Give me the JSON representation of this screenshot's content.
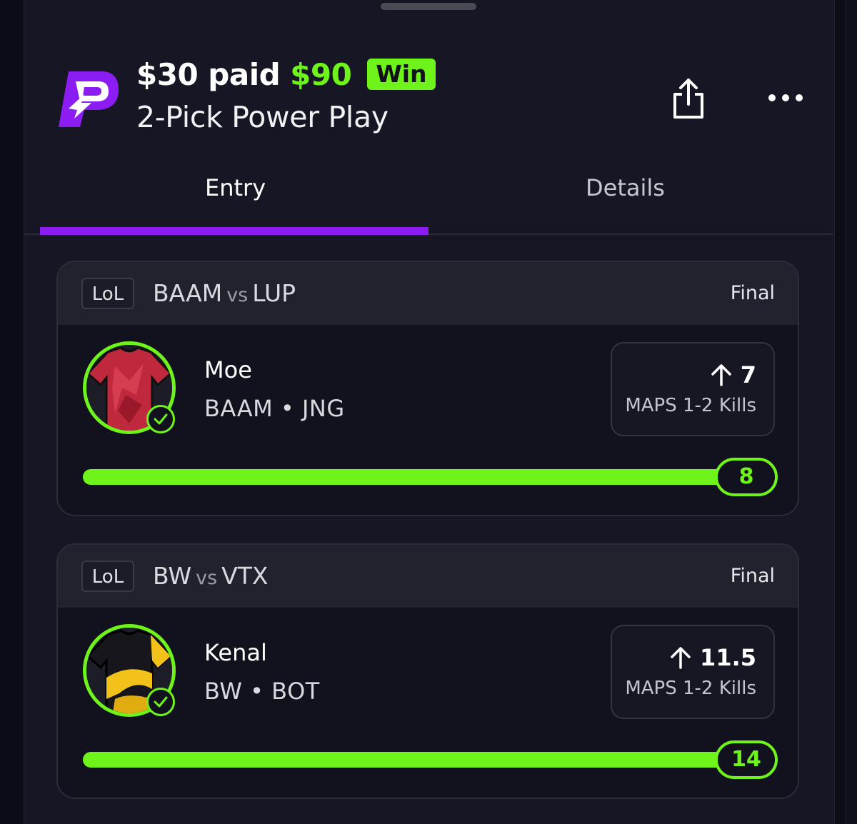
{
  "header": {
    "paid_amount": "$30 paid",
    "payout": "$90",
    "result_badge": "Win",
    "entry_type": "2-Pick Power Play"
  },
  "tabs": [
    {
      "label": "Entry",
      "active": true
    },
    {
      "label": "Details",
      "active": false
    }
  ],
  "picks": [
    {
      "league": "LoL",
      "team_a": "BAAM",
      "vs": "vs",
      "team_b": "LUP",
      "status": "Final",
      "player": "Moe",
      "meta": "BAAM • JNG",
      "direction": "up-arrow-icon",
      "line": "7",
      "stat": "MAPS 1-2 Kills",
      "result": "8",
      "progress": 1.0
    },
    {
      "league": "LoL",
      "team_a": "BW",
      "vs": "vs",
      "team_b": "VTX",
      "status": "Final",
      "player": "Kenal",
      "meta": "BW • BOT",
      "direction": "up-arrow-icon",
      "line": "11.5",
      "stat": "MAPS 1-2 Kills",
      "result": "14",
      "progress": 1.0
    }
  ],
  "colors": {
    "accent_green": "#6ef41a",
    "accent_purple": "#8b1cf2",
    "background": "#161624"
  }
}
